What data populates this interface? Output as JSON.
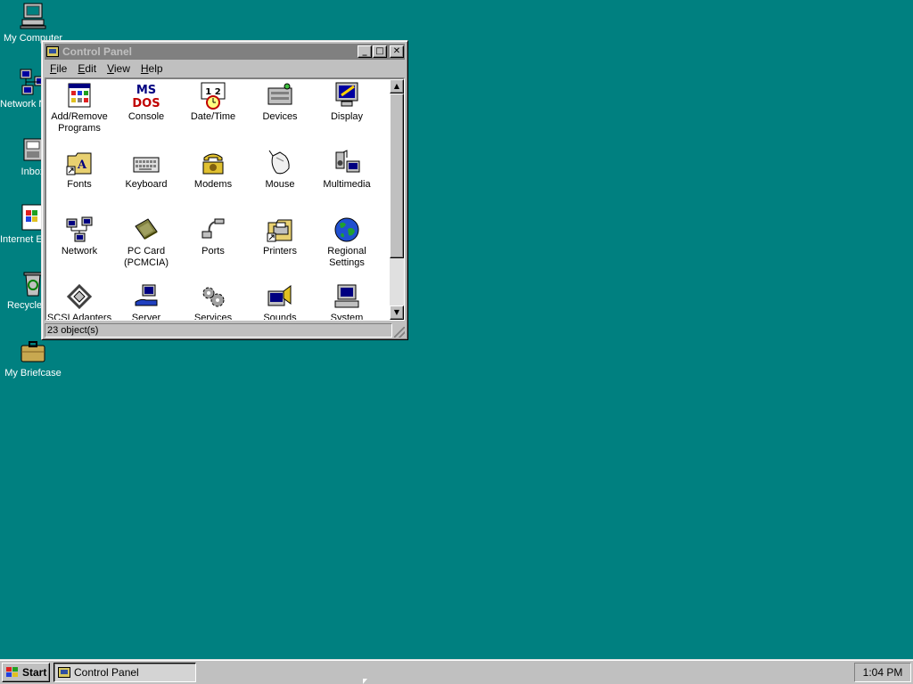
{
  "desktop": {
    "background_color": "#008080",
    "icons": [
      {
        "label": "My Computer",
        "icon": "my-computer-icon"
      },
      {
        "label": "Network Neighborhood",
        "icon": "network-neighborhood-icon"
      },
      {
        "label": "Inbox",
        "icon": "inbox-icon"
      },
      {
        "label": "Internet Explorer",
        "icon": "internet-explorer-icon"
      },
      {
        "label": "Recycle Bin",
        "icon": "recycle-bin-icon"
      },
      {
        "label": "My Briefcase",
        "icon": "briefcase-icon"
      }
    ]
  },
  "window": {
    "title": "Control Panel",
    "controls": {
      "minimize": "_",
      "maximize": "□",
      "close": "✕"
    },
    "menu": [
      {
        "label": "File",
        "accel": "F"
      },
      {
        "label": "Edit",
        "accel": "E"
      },
      {
        "label": "View",
        "accel": "V"
      },
      {
        "label": "Help",
        "accel": "H"
      }
    ],
    "items": [
      {
        "label": "Add/Remove Programs",
        "icon": "add-remove-programs-icon"
      },
      {
        "label": "Console",
        "icon": "console-icon"
      },
      {
        "label": "Date/Time",
        "icon": "date-time-icon"
      },
      {
        "label": "Devices",
        "icon": "devices-icon"
      },
      {
        "label": "Display",
        "icon": "display-icon"
      },
      {
        "label": "Fonts",
        "icon": "fonts-icon"
      },
      {
        "label": "Keyboard",
        "icon": "keyboard-icon"
      },
      {
        "label": "Modems",
        "icon": "modems-icon"
      },
      {
        "label": "Mouse",
        "icon": "mouse-icon"
      },
      {
        "label": "Multimedia",
        "icon": "multimedia-icon"
      },
      {
        "label": "Network",
        "icon": "network-icon"
      },
      {
        "label": "PC Card (PCMCIA)",
        "icon": "pc-card-icon"
      },
      {
        "label": "Ports",
        "icon": "ports-icon"
      },
      {
        "label": "Printers",
        "icon": "printers-icon"
      },
      {
        "label": "Regional Settings",
        "icon": "regional-settings-icon"
      },
      {
        "label": "SCSI Adapters",
        "icon": "scsi-adapters-icon"
      },
      {
        "label": "Server",
        "icon": "server-icon"
      },
      {
        "label": "Services",
        "icon": "services-icon"
      },
      {
        "label": "Sounds",
        "icon": "sounds-icon"
      },
      {
        "label": "System",
        "icon": "system-icon"
      }
    ],
    "status": "23 object(s)",
    "scroll_position": 0
  },
  "taskbar": {
    "start_label": "Start",
    "tasks": [
      {
        "label": "Control Panel",
        "icon": "control-panel-icon"
      }
    ],
    "clock": "1:04 PM"
  }
}
